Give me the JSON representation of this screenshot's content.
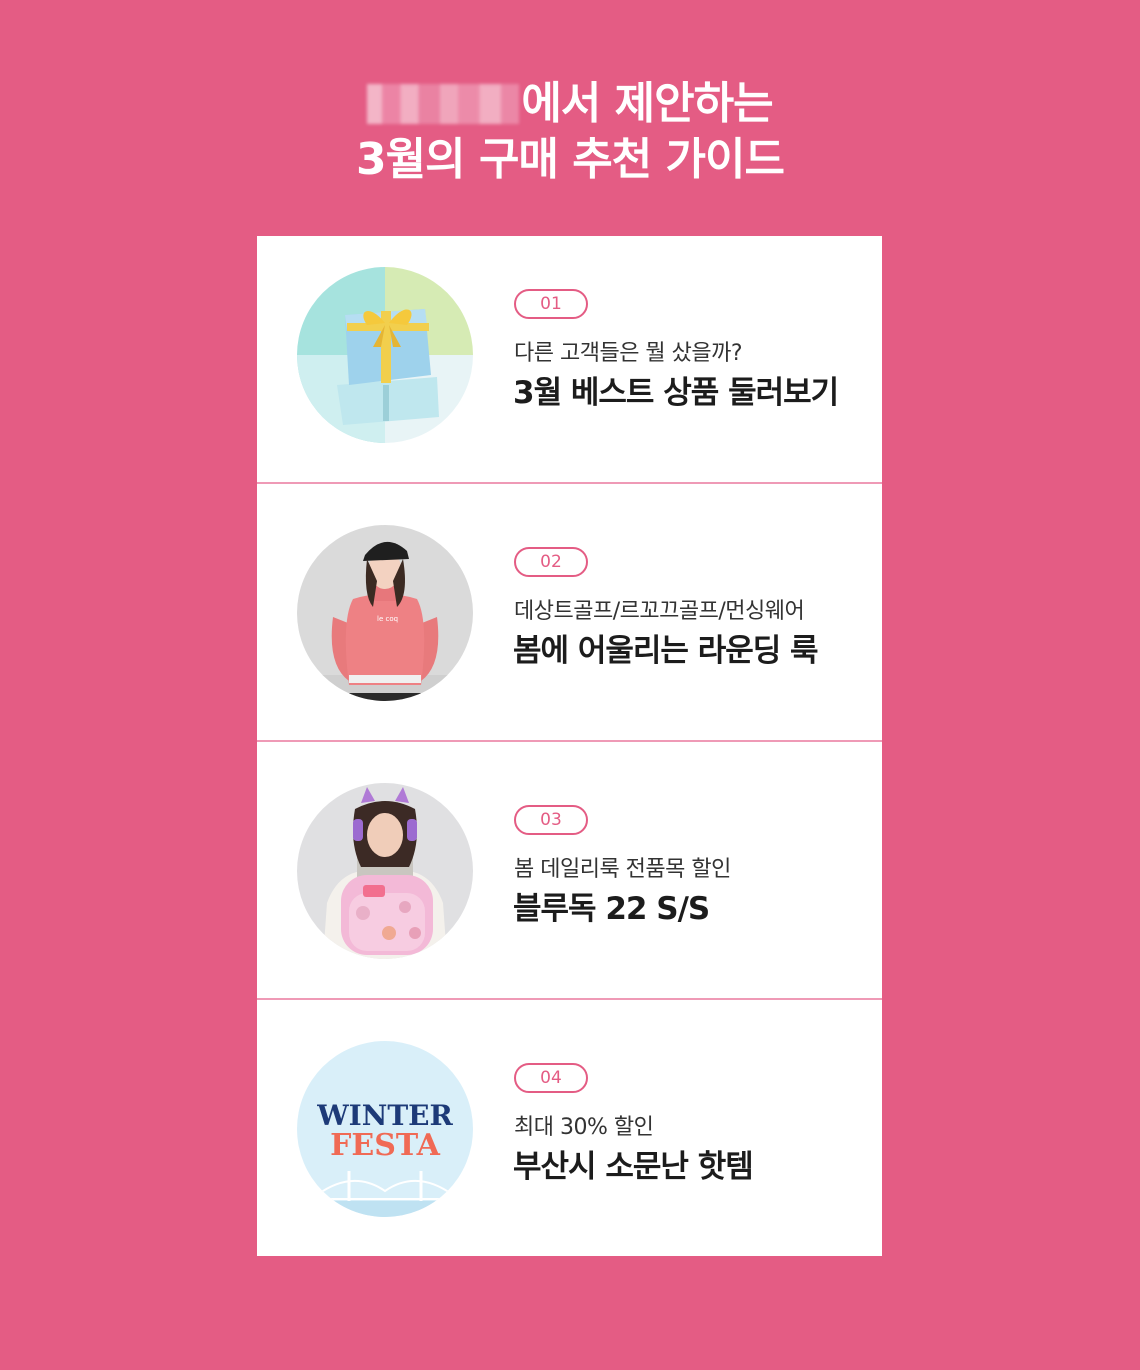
{
  "header": {
    "line1_suffix": "에서 제안하는",
    "line2": "3월의 구매 추천 가이드"
  },
  "items": [
    {
      "number": "01",
      "subtitle": "다른 고객들은 뭘 샀을까?",
      "title": "3월 베스트 상품 둘러보기",
      "image": "gift-box-image"
    },
    {
      "number": "02",
      "subtitle": "데상트골프/르꼬끄골프/먼싱웨어",
      "title": "봄에 어울리는 라운딩 룩",
      "image": "golf-model-image"
    },
    {
      "number": "03",
      "subtitle": "봄 데일리룩 전품목 할인",
      "title": "블루독 22 S/S",
      "image": "kid-backpack-image"
    },
    {
      "number": "04",
      "subtitle": "최대 30% 할인",
      "title": "부산시 소문난 핫템",
      "image": "winter-festa-image",
      "image_text": {
        "line1": "WINTER",
        "line2": "FESTA"
      }
    }
  ],
  "colors": {
    "background": "#e45c84",
    "card": "#ffffff",
    "accent": "#e45c84",
    "divider": "#ef9ab6"
  }
}
